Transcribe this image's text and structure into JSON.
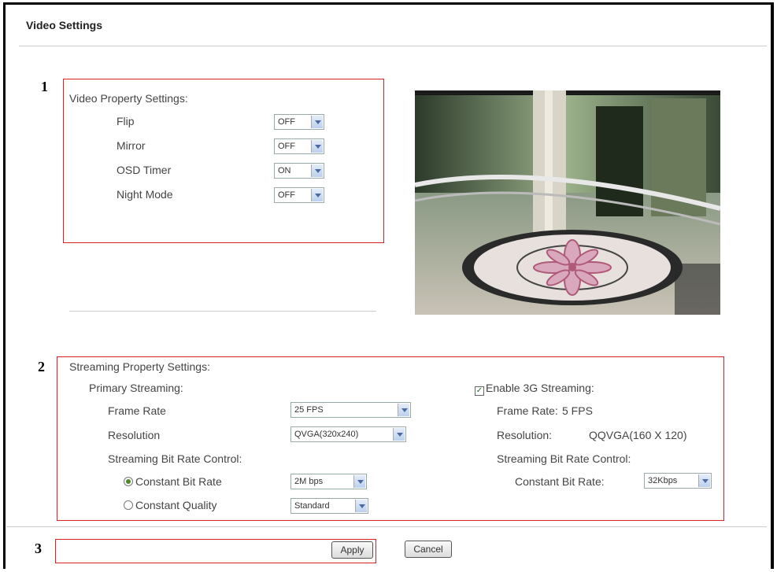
{
  "page_title": "Video Settings",
  "markers": [
    "1",
    "2",
    "3"
  ],
  "video_property": {
    "heading": "Video Property Settings:",
    "rows": [
      {
        "label": "Flip",
        "value": "OFF"
      },
      {
        "label": "Mirror",
        "value": "OFF"
      },
      {
        "label": "OSD Timer",
        "value": "ON"
      },
      {
        "label": "Night Mode",
        "value": "OFF"
      }
    ]
  },
  "streaming": {
    "heading": "Streaming Property Settings:",
    "primary": {
      "heading": "Primary Streaming:",
      "frame_rate_label": "Frame Rate",
      "frame_rate_value": "25 FPS",
      "resolution_label": "Resolution",
      "resolution_value": "QVGA(320x240)",
      "bitrate_control_label": "Streaming Bit Rate Control:",
      "constant_bit_rate_label": "Constant Bit Rate",
      "constant_bit_rate_value": "2M bps",
      "constant_quality_label": "Constant Quality",
      "constant_quality_value": "Standard"
    },
    "threeg": {
      "enable_label": "Enable 3G Streaming:",
      "enabled": true,
      "frame_rate_label": "Frame Rate:",
      "frame_rate_value": "5 FPS",
      "resolution_label": "Resolution:",
      "resolution_value": "QQVGA(160 X 120)",
      "bitrate_control_label": "Streaming Bit Rate Control:",
      "constant_bit_rate_label": "Constant Bit Rate:",
      "constant_bit_rate_value": "32Kbps"
    }
  },
  "buttons": {
    "apply": "Apply",
    "cancel": "Cancel"
  },
  "colors": {
    "highlight_box": "#e02020",
    "select_arrow": "#4a6aa0"
  }
}
